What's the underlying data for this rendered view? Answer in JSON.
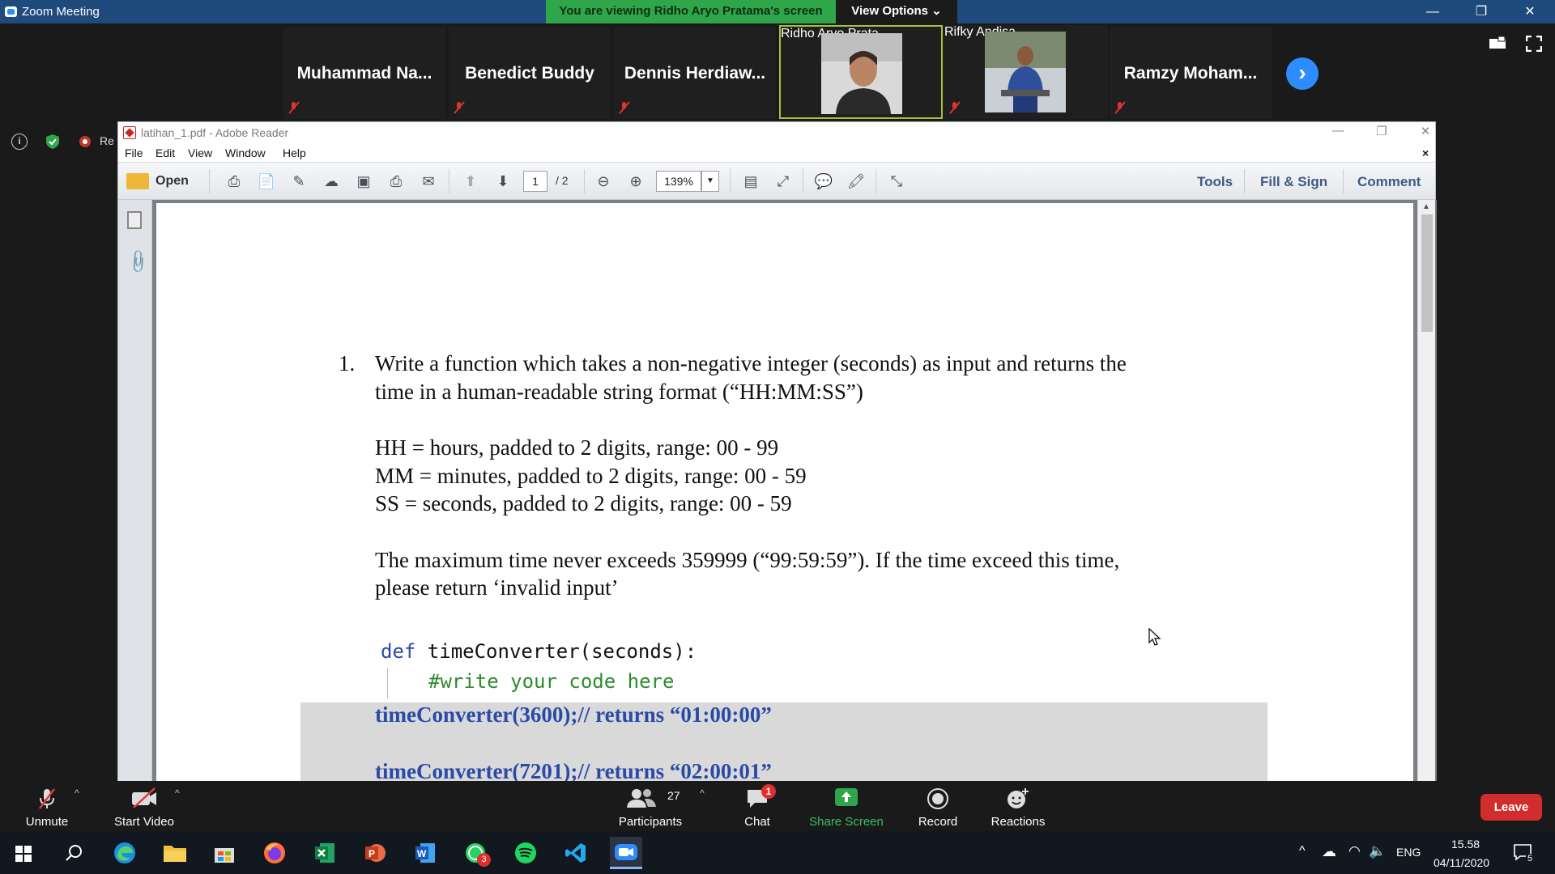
{
  "window": {
    "title": "Zoom Meeting"
  },
  "banner": {
    "viewing": "You are viewing Ridho Aryo Pratama's screen",
    "view_options": "View Options ⌄"
  },
  "participants": [
    {
      "name": "Muhammad  Na..."
    },
    {
      "name": "Benedict Buddy"
    },
    {
      "name": "Dennis  Herdiaw..."
    },
    {
      "name": "Ridho Aryo Prata..."
    },
    {
      "name": "Rifky Andisa"
    },
    {
      "name": "Ramzy  Moham..."
    }
  ],
  "side": {
    "recording_label": "Re"
  },
  "reader": {
    "title": "latihan_1.pdf - Adobe Reader",
    "menu": [
      "File",
      "Edit",
      "View",
      "Window",
      "Help"
    ],
    "open_label": "Open",
    "page_current": "1",
    "page_total": "/ 2",
    "zoom": "139%",
    "tools": "Tools",
    "fill_sign": "Fill & Sign",
    "comment": "Comment"
  },
  "doc": {
    "num": "1.",
    "line1": "Write a function which takes a non-negative integer (seconds) as input and returns the",
    "line2": "time in a human-readable string format (“HH:MM:SS”)",
    "hh": "HH = hours, padded to 2 digits, range: 00 - 99",
    "mm": "MM = minutes, padded to 2 digits, range: 00 - 59",
    "ss": "SS = seconds, padded to 2 digits, range: 00 - 59",
    "max1": "The maximum time never exceeds 359999 (“99:59:59”). If the time exceed this time,",
    "max2": "please return ‘invalid input’",
    "code_kw": "def",
    "code_fn": " timeConverter(seconds):",
    "code_comment": "#write your code here",
    "ex1": "timeConverter(3600);// returns “01:00:00”",
    "ex2": "timeConverter(7201);// returns “02:00:01”"
  },
  "controls": {
    "unmute": "Unmute",
    "start_video": "Start Video",
    "participants": "Participants",
    "participants_count": "27",
    "chat": "Chat",
    "chat_badge": "1",
    "share": "Share Screen",
    "record": "Record",
    "reactions": "Reactions",
    "leave": "Leave"
  },
  "taskbar": {
    "whatsapp_badge": "3",
    "lang": "ENG",
    "time": "15.58",
    "date": "04/11/2020",
    "notif_count": "5"
  },
  "colors": {
    "share_green": "#2fa64a",
    "zoom_blue": "#2d8cff",
    "leave_red": "#d12d2d",
    "code_blue": "#2a4aa8",
    "code_green": "#2e8b2e"
  }
}
